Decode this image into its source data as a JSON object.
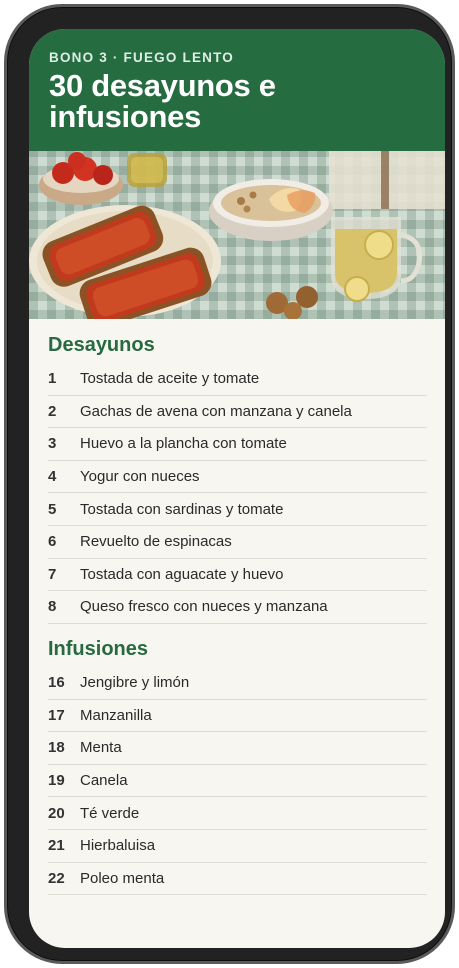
{
  "header": {
    "eyebrow": "BONO 3 · FUEGO LENTO",
    "title": "30 desayunos e infusiones"
  },
  "hero": {
    "image_icon": "breakfast-photo"
  },
  "sections": {
    "breakfasts": {
      "title": "Desayunos",
      "items": [
        {
          "num": "1",
          "label": "Tostada de aceite y tomate"
        },
        {
          "num": "2",
          "label": "Gachas de avena con manzana y canela"
        },
        {
          "num": "3",
          "label": "Huevo a la plancha con tomate"
        },
        {
          "num": "4",
          "label": "Yogur con nueces"
        },
        {
          "num": "5",
          "label": "Tostada con sardinas y tomate"
        },
        {
          "num": "6",
          "label": "Revuelto de espinacas"
        },
        {
          "num": "7",
          "label": "Tostada con aguacate y huevo"
        },
        {
          "num": "8",
          "label": "Queso fresco con nueces y manzana"
        }
      ]
    },
    "infusions": {
      "title": "Infusiones",
      "items": [
        {
          "num": "16",
          "label": "Jengibre y limón"
        },
        {
          "num": "17",
          "label": "Manzanilla"
        },
        {
          "num": "18",
          "label": "Menta"
        },
        {
          "num": "19",
          "label": "Canela"
        },
        {
          "num": "20",
          "label": "Té verde"
        },
        {
          "num": "21",
          "label": "Hierbaluisa"
        },
        {
          "num": "22",
          "label": "Poleo menta"
        }
      ]
    }
  },
  "colors": {
    "header_bg": "#256c41",
    "accent": "#276a40",
    "page_bg": "#f8f6f1"
  }
}
